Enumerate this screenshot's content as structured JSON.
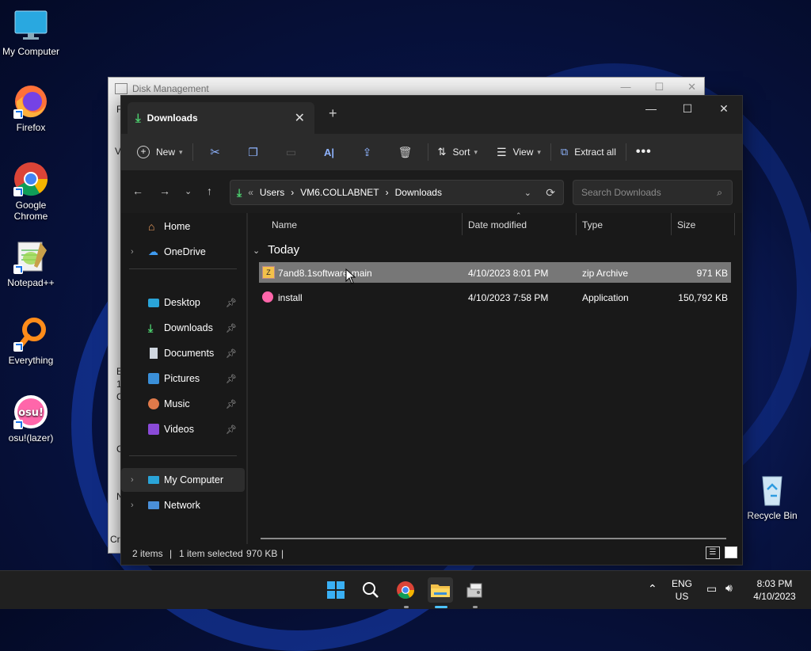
{
  "desktop": {
    "icons": [
      {
        "label": "My Computer",
        "icon": "monitor-icon"
      },
      {
        "label": "Firefox",
        "icon": "firefox-icon"
      },
      {
        "label": "Google Chrome",
        "icon": "chrome-icon"
      },
      {
        "label": "Notepad++",
        "icon": "notepadpp-icon"
      },
      {
        "label": "Everything",
        "icon": "everything-search-icon"
      },
      {
        "label": "osu!(lazer)",
        "icon": "osu-icon"
      }
    ],
    "recycle_bin": "Recycle Bin"
  },
  "disk_management": {
    "title": "Disk Management",
    "left_edge_text": [
      "F",
      "V",
      "E",
      "1",
      "C",
      "C",
      "N",
      "Cr"
    ]
  },
  "explorer": {
    "tab_title": "Downloads",
    "toolbar": {
      "new": "New",
      "sort": "Sort",
      "view": "View",
      "extract_all": "Extract all"
    },
    "breadcrumb": [
      "Users",
      "VM6.COLLABNET",
      "Downloads"
    ],
    "search_placeholder": "Search Downloads",
    "sidebar": {
      "home": "Home",
      "onedrive": "OneDrive",
      "desktop": "Desktop",
      "downloads": "Downloads",
      "documents": "Documents",
      "pictures": "Pictures",
      "music": "Music",
      "videos": "Videos",
      "my_computer": "My Computer",
      "network": "Network"
    },
    "columns": {
      "name": "Name",
      "date": "Date modified",
      "type": "Type",
      "size": "Size"
    },
    "group": "Today",
    "files": [
      {
        "name": "7and8.1software-main",
        "date": "4/10/2023 8:01 PM",
        "type": "zip Archive",
        "size": "971 KB",
        "selected": true
      },
      {
        "name": "install",
        "date": "4/10/2023 7:58 PM",
        "type": "Application",
        "size": "150,792 KB",
        "selected": false
      }
    ],
    "status": {
      "items": "2 items",
      "selected": "1 item selected",
      "size": "970 KB"
    }
  },
  "taskbar": {
    "lang": "ENG",
    "region": "US",
    "time": "8:03 PM",
    "date": "4/10/2023"
  },
  "colors": {
    "accent": "#4cc2ff",
    "selection": "#777777",
    "folder": "#f3c14a"
  }
}
